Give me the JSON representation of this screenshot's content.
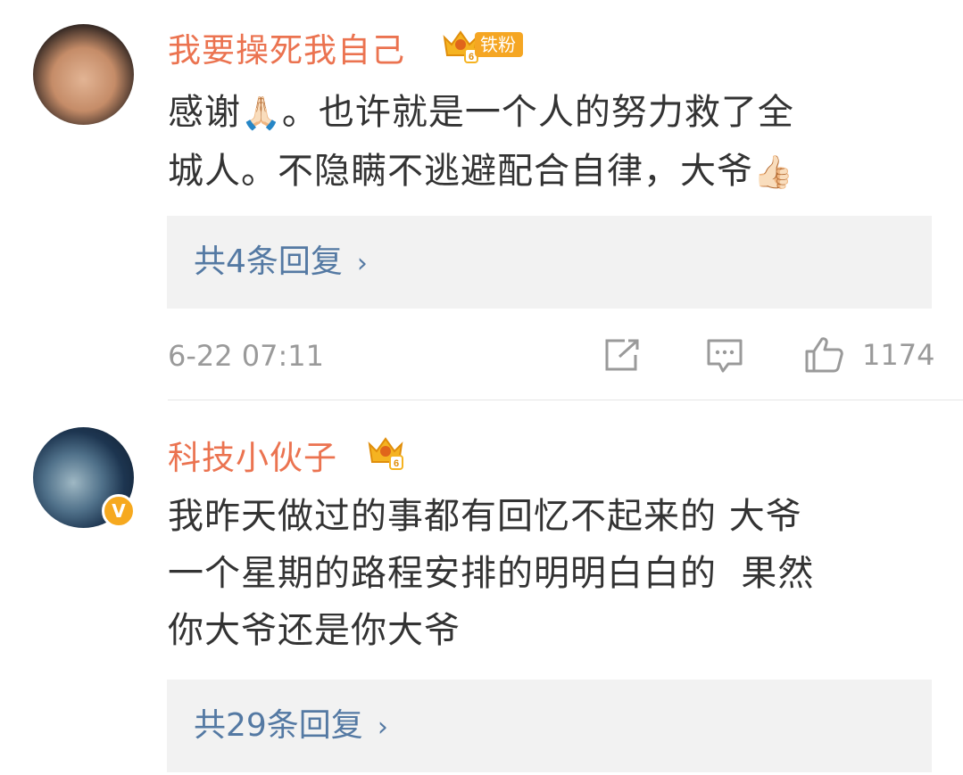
{
  "comments": [
    {
      "username": "我要操死我自己",
      "badge_level": "6",
      "badge_tag": "铁粉",
      "body_lines": [
        {
          "before": "感谢",
          "emoji": "🙏🏻",
          "after": "。也许就是一个人的努力救了全"
        },
        {
          "before": "城人。不隐瞒不逃避配合自律，大爷",
          "emoji": "👍🏻",
          "after": ""
        }
      ],
      "replies_label": "共4条回复",
      "replies_chevron": "›",
      "time": "6-22 07:11",
      "like_count": "1174"
    },
    {
      "username": "科技小伙子",
      "badge_level": "6",
      "verified_mark": "V",
      "body_lines": [
        "我昨天做过的事都有回忆不起来的 大爷",
        "一个星期的路程安排的明明白白的  果然",
        "你大爷还是你大爷"
      ],
      "replies_label": "共29条回复",
      "replies_chevron": "›"
    }
  ],
  "colors": {
    "username": "#eb7350",
    "link": "#5479a3",
    "meta": "#9a9a9a",
    "badge": "#f5a623"
  },
  "icons": {
    "level_badge": "crown-badge-icon",
    "repost": "repost-icon",
    "comment": "comment-icon",
    "like": "thumbs-up-icon",
    "verified": "verified-v-icon"
  }
}
